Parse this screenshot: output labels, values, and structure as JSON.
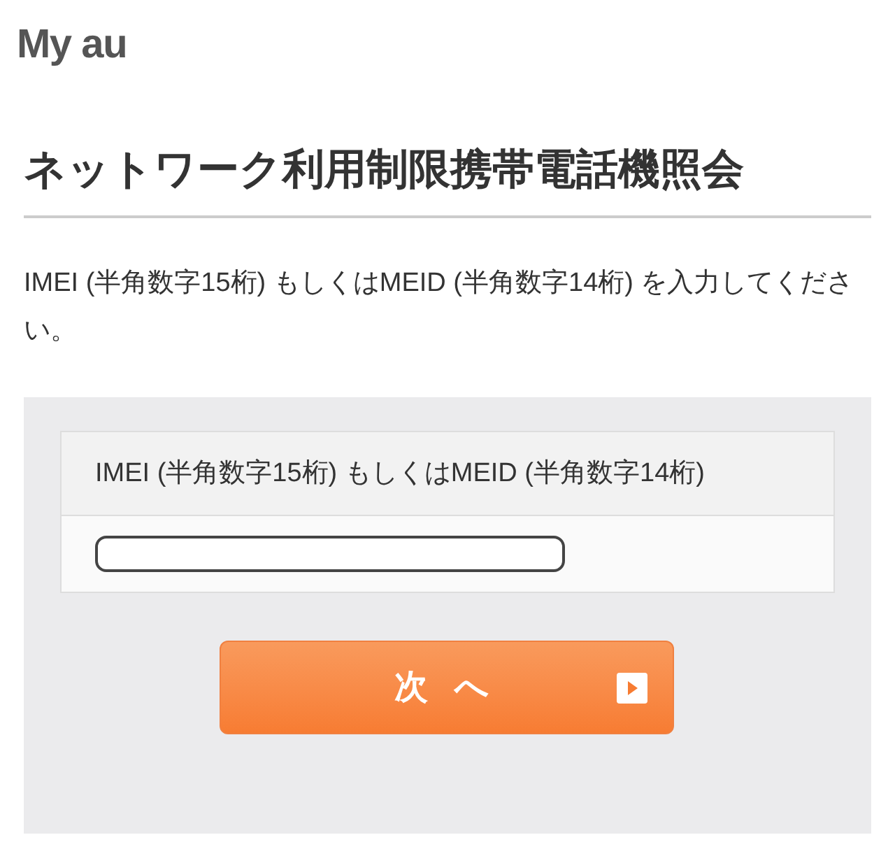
{
  "logo": "My au",
  "title": "ネットワーク利用制限携帯電話機照会",
  "instruction": "IMEI (半角数字15桁) もしくはMEID (半角数字14桁) を入力してください。",
  "form": {
    "label": "IMEI (半角数字15桁) もしくはMEID (半角数字14桁)"
  },
  "next_button": "次 へ"
}
